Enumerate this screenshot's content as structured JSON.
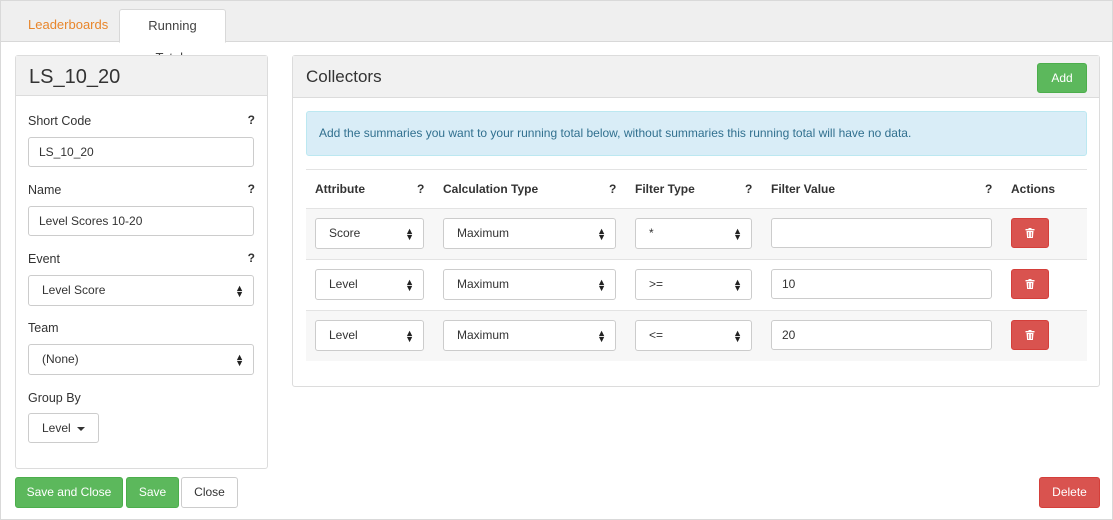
{
  "tabs": {
    "leaderboards": "Leaderboards",
    "running_totals": "Running Totals"
  },
  "left": {
    "title": "LS_10_20",
    "short_code": {
      "label": "Short Code",
      "value": "LS_10_20",
      "help": "?"
    },
    "name": {
      "label": "Name",
      "value": "Level Scores 10-20",
      "help": "?"
    },
    "event": {
      "label": "Event",
      "value": "Level Score",
      "help": "?"
    },
    "team": {
      "label": "Team",
      "value": "(None)"
    },
    "group_by": {
      "label": "Group By",
      "value": "Level"
    }
  },
  "collectors": {
    "title": "Collectors",
    "add_label": "Add",
    "info": "Add the summaries you want to your running total below, without summaries this running total will have no data.",
    "headers": {
      "attribute": "Attribute",
      "calc_type": "Calculation Type",
      "filter_type": "Filter Type",
      "filter_value": "Filter Value",
      "actions": "Actions",
      "help": "?"
    },
    "rows": [
      {
        "attribute": "Score",
        "calc_type": "Maximum",
        "filter_type": "*",
        "filter_value": ""
      },
      {
        "attribute": "Level",
        "calc_type": "Maximum",
        "filter_type": ">=",
        "filter_value": "10"
      },
      {
        "attribute": "Level",
        "calc_type": "Maximum",
        "filter_type": "<=",
        "filter_value": "20"
      }
    ]
  },
  "footer": {
    "save_close": "Save and Close",
    "save": "Save",
    "close": "Close",
    "delete": "Delete"
  },
  "colors": {
    "green": "#5cb85c",
    "red": "#d9534f",
    "orange": "#e8862b",
    "info_bg": "#d9edf7"
  },
  "icons": {
    "trash": "trash-icon",
    "select_caret": "sort-caret-icon",
    "dropdown": "caret-down-icon"
  }
}
